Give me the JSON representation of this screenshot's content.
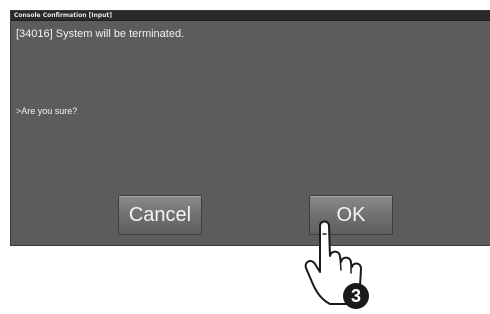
{
  "window": {
    "title": "Console Confirmation [Input]"
  },
  "message": {
    "line1": "[34016] System will be terminated.",
    "line2": ">Are you sure?"
  },
  "buttons": {
    "cancel_label": "Cancel",
    "ok_label": "OK"
  },
  "annotation": {
    "step_number": "3",
    "pointer_icon": "hand-pointer-icon"
  },
  "colors": {
    "dialog_background": "#5c5c5c",
    "titlebar_background": "#2a2a2a",
    "button_face": "#6f6f6f",
    "text": "#f2f2f2",
    "step_badge": "#1a1a1a"
  }
}
